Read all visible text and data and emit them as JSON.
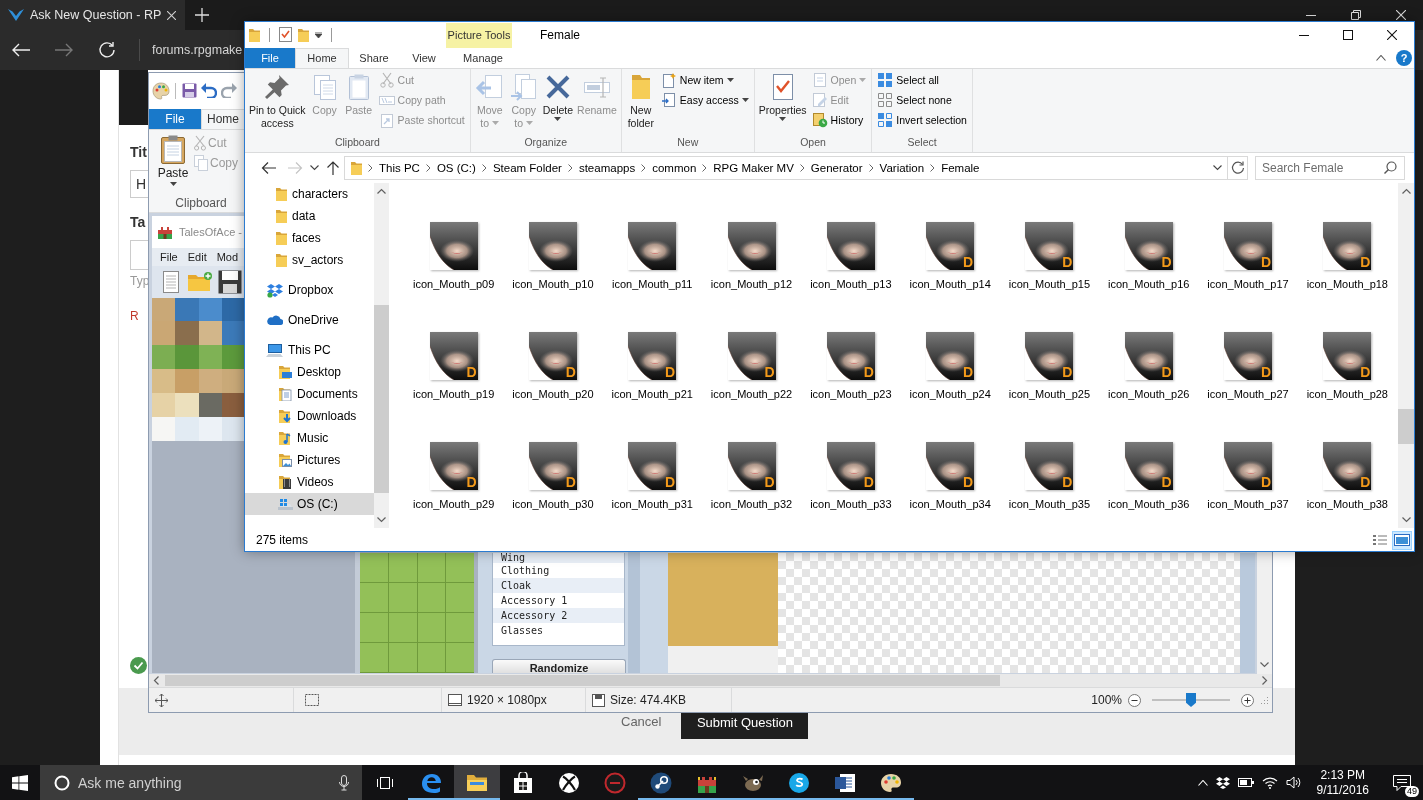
{
  "browser": {
    "tab": {
      "title": "Ask New Question - RP",
      "selected": true
    },
    "address": "forums.rpgmake"
  },
  "web_page": {
    "title_label": "Tit",
    "title_value": "H",
    "tags_label": "Ta",
    "tags_hint": "Typ",
    "required_note": "R",
    "cancel": "Cancel",
    "submit": "Submit Question"
  },
  "paint": {
    "tabs": [
      {
        "label": "File",
        "kind": "menu",
        "selected": false
      },
      {
        "label": "Home",
        "kind": "tab",
        "selected": true
      }
    ],
    "clipboard": {
      "label": "Clipboard",
      "commands": [
        {
          "label": "Paste",
          "kind": "large",
          "disabled": false,
          "dropdown": true
        },
        {
          "label": "Cut",
          "kind": "small",
          "disabled": true,
          "dropdown": false
        },
        {
          "label": "Copy",
          "kind": "small",
          "disabled": true,
          "dropdown": false
        }
      ]
    },
    "canvas_image": {
      "title": "TalesOfAce -",
      "menu": [
        "File",
        "Edit",
        "Mod"
      ],
      "parts": [
        "Wing",
        "Clothing",
        "Cloak",
        "Accessory 1",
        "Accessory 2",
        "Glasses"
      ],
      "randomize": "Randomize"
    },
    "status": {
      "dimensions": "1920 × 1080px",
      "size": "Size: 474.4KB",
      "zoom": {
        "reading": "100%",
        "level": 0.5
      }
    }
  },
  "explorer": {
    "context_label": "Picture Tools",
    "title": "Female",
    "tabs": [
      {
        "label": "File",
        "kind": "menu",
        "selected": false
      },
      {
        "label": "Home",
        "kind": "tab",
        "selected": true
      },
      {
        "label": "Share",
        "kind": "tab",
        "selected": false
      },
      {
        "label": "View",
        "kind": "tab",
        "selected": false
      },
      {
        "label": "Manage",
        "kind": "contextual",
        "selected": false
      }
    ],
    "help": "?",
    "ribbon": [
      {
        "label": "Clipboard",
        "commands": [
          {
            "label": "Pin to Quick\naccess",
            "kind": "large",
            "disabled": false,
            "dropdown": false
          },
          {
            "label": "Copy",
            "kind": "large",
            "disabled": true,
            "dropdown": false
          },
          {
            "label": "Paste",
            "kind": "large",
            "disabled": true,
            "dropdown": false
          },
          {
            "label": "Cut",
            "kind": "small",
            "disabled": true,
            "dropdown": false
          },
          {
            "label": "Copy path",
            "kind": "small",
            "disabled": true,
            "dropdown": false
          },
          {
            "label": "Paste shortcut",
            "kind": "small",
            "disabled": true,
            "dropdown": false
          }
        ]
      },
      {
        "label": "Organize",
        "commands": [
          {
            "label": "Move\nto",
            "kind": "large",
            "disabled": true,
            "dropdown": true
          },
          {
            "label": "Copy\nto",
            "kind": "large",
            "disabled": true,
            "dropdown": true
          },
          {
            "label": "Delete",
            "kind": "large",
            "disabled": false,
            "dropdown": true
          },
          {
            "label": "Rename",
            "kind": "large",
            "disabled": true,
            "dropdown": false
          }
        ]
      },
      {
        "label": "New",
        "commands": [
          {
            "label": "New\nfolder",
            "kind": "large",
            "disabled": false,
            "dropdown": false
          },
          {
            "label": "New item",
            "kind": "small",
            "disabled": false,
            "dropdown": true
          },
          {
            "label": "Easy access",
            "kind": "small",
            "disabled": false,
            "dropdown": true
          }
        ]
      },
      {
        "label": "Open",
        "commands": [
          {
            "label": "Properties",
            "kind": "large",
            "disabled": false,
            "dropdown": true
          },
          {
            "label": "Open",
            "kind": "small",
            "disabled": true,
            "dropdown": true
          },
          {
            "label": "Edit",
            "kind": "small",
            "disabled": true,
            "dropdown": false
          },
          {
            "label": "History",
            "kind": "small",
            "disabled": false,
            "dropdown": false
          }
        ]
      },
      {
        "label": "Select",
        "commands": [
          {
            "label": "Select all",
            "kind": "small",
            "disabled": false,
            "dropdown": false
          },
          {
            "label": "Select none",
            "kind": "small",
            "disabled": false,
            "dropdown": false
          },
          {
            "label": "Invert selection",
            "kind": "small",
            "disabled": false,
            "dropdown": false
          }
        ]
      }
    ],
    "address_buttons": [
      {
        "kind": "back",
        "disabled": false
      },
      {
        "kind": "forward",
        "disabled": true
      },
      {
        "kind": "recent",
        "disabled": false
      },
      {
        "kind": "up",
        "disabled": false
      }
    ],
    "breadcrumb": [
      "This PC",
      "OS (C:)",
      "Steam Folder",
      "steamapps",
      "common",
      "RPG Maker MV",
      "Generator",
      "Variation",
      "Female"
    ],
    "search": {
      "placeholder": "Search Female"
    },
    "nav_pane": {
      "folders": [
        {
          "label": "characters",
          "kind": "folder",
          "selected": false
        },
        {
          "label": "data",
          "kind": "folder",
          "selected": false
        },
        {
          "label": "faces",
          "kind": "folder",
          "selected": false
        },
        {
          "label": "sv_actors",
          "kind": "folder",
          "selected": false
        }
      ],
      "places": [
        {
          "label": "Dropbox",
          "kind": "sync",
          "selected": false
        },
        {
          "label": "OneDrive",
          "kind": "cloud",
          "selected": false
        },
        {
          "label": "This PC",
          "kind": "computer",
          "selected": false,
          "children": [
            {
              "label": "Desktop",
              "kind": "desktop",
              "selected": false
            },
            {
              "label": "Documents",
              "kind": "documents",
              "selected": false
            },
            {
              "label": "Downloads",
              "kind": "downloads",
              "selected": false
            },
            {
              "label": "Music",
              "kind": "music",
              "selected": false
            },
            {
              "label": "Pictures",
              "kind": "pictures",
              "selected": false
            },
            {
              "label": "Videos",
              "kind": "videos",
              "selected": false
            },
            {
              "label": "OS (C:)",
              "kind": "drive",
              "selected": true
            }
          ]
        }
      ]
    },
    "items": [
      {
        "name": "icon_Mouth_p09"
      },
      {
        "name": "icon_Mouth_p10"
      },
      {
        "name": "icon_Mouth_p11"
      },
      {
        "name": "icon_Mouth_p12"
      },
      {
        "name": "icon_Mouth_p13"
      },
      {
        "name": "icon_Mouth_p14",
        "badge": "D"
      },
      {
        "name": "icon_Mouth_p15",
        "badge": "D"
      },
      {
        "name": "icon_Mouth_p16",
        "badge": "D"
      },
      {
        "name": "icon_Mouth_p17",
        "badge": "D"
      },
      {
        "name": "icon_Mouth_p18",
        "badge": "D"
      },
      {
        "name": "icon_Mouth_p19",
        "badge": "D"
      },
      {
        "name": "icon_Mouth_p20",
        "badge": "D"
      },
      {
        "name": "icon_Mouth_p21",
        "badge": "D"
      },
      {
        "name": "icon_Mouth_p22",
        "badge": "D"
      },
      {
        "name": "icon_Mouth_p23",
        "badge": "D"
      },
      {
        "name": "icon_Mouth_p24",
        "badge": "D"
      },
      {
        "name": "icon_Mouth_p25",
        "badge": "D"
      },
      {
        "name": "icon_Mouth_p26",
        "badge": "D"
      },
      {
        "name": "icon_Mouth_p27",
        "badge": "D"
      },
      {
        "name": "icon_Mouth_p28",
        "badge": "D"
      },
      {
        "name": "icon_Mouth_p29",
        "badge": "D"
      },
      {
        "name": "icon_Mouth_p30",
        "badge": "D"
      },
      {
        "name": "icon_Mouth_p31",
        "badge": "D"
      },
      {
        "name": "icon_Mouth_p32",
        "badge": "D"
      },
      {
        "name": "icon_Mouth_p33",
        "badge": "D"
      },
      {
        "name": "icon_Mouth_p34",
        "badge": "D"
      },
      {
        "name": "icon_Mouth_p35",
        "badge": "D"
      },
      {
        "name": "icon_Mouth_p36",
        "badge": "D"
      },
      {
        "name": "icon_Mouth_p37",
        "badge": "D"
      },
      {
        "name": "icon_Mouth_p38",
        "badge": "D"
      }
    ],
    "status": {
      "count": "275 items",
      "views": [
        {
          "kind": "details",
          "selected": false
        },
        {
          "kind": "thumbnails",
          "selected": true
        }
      ]
    }
  },
  "taskbar": {
    "search_placeholder": "Ask me anything",
    "apps": [
      {
        "kind": "browser",
        "running": true,
        "selected": false
      },
      {
        "kind": "files",
        "running": true,
        "selected": true
      },
      {
        "kind": "store",
        "running": false,
        "selected": false
      },
      {
        "kind": "console",
        "running": false,
        "selected": false
      },
      {
        "kind": "overlay",
        "running": false,
        "selected": false
      },
      {
        "kind": "games",
        "running": true,
        "selected": false
      },
      {
        "kind": "maker",
        "running": true,
        "selected": false
      },
      {
        "kind": "editor",
        "running": true,
        "selected": false
      },
      {
        "kind": "chat",
        "running": true,
        "selected": false
      },
      {
        "kind": "writer",
        "running": true,
        "selected": false
      },
      {
        "kind": "paint",
        "running": true,
        "selected": false
      }
    ],
    "time": "2:13 PM",
    "date": "9/11/2016",
    "notifications": "49"
  }
}
